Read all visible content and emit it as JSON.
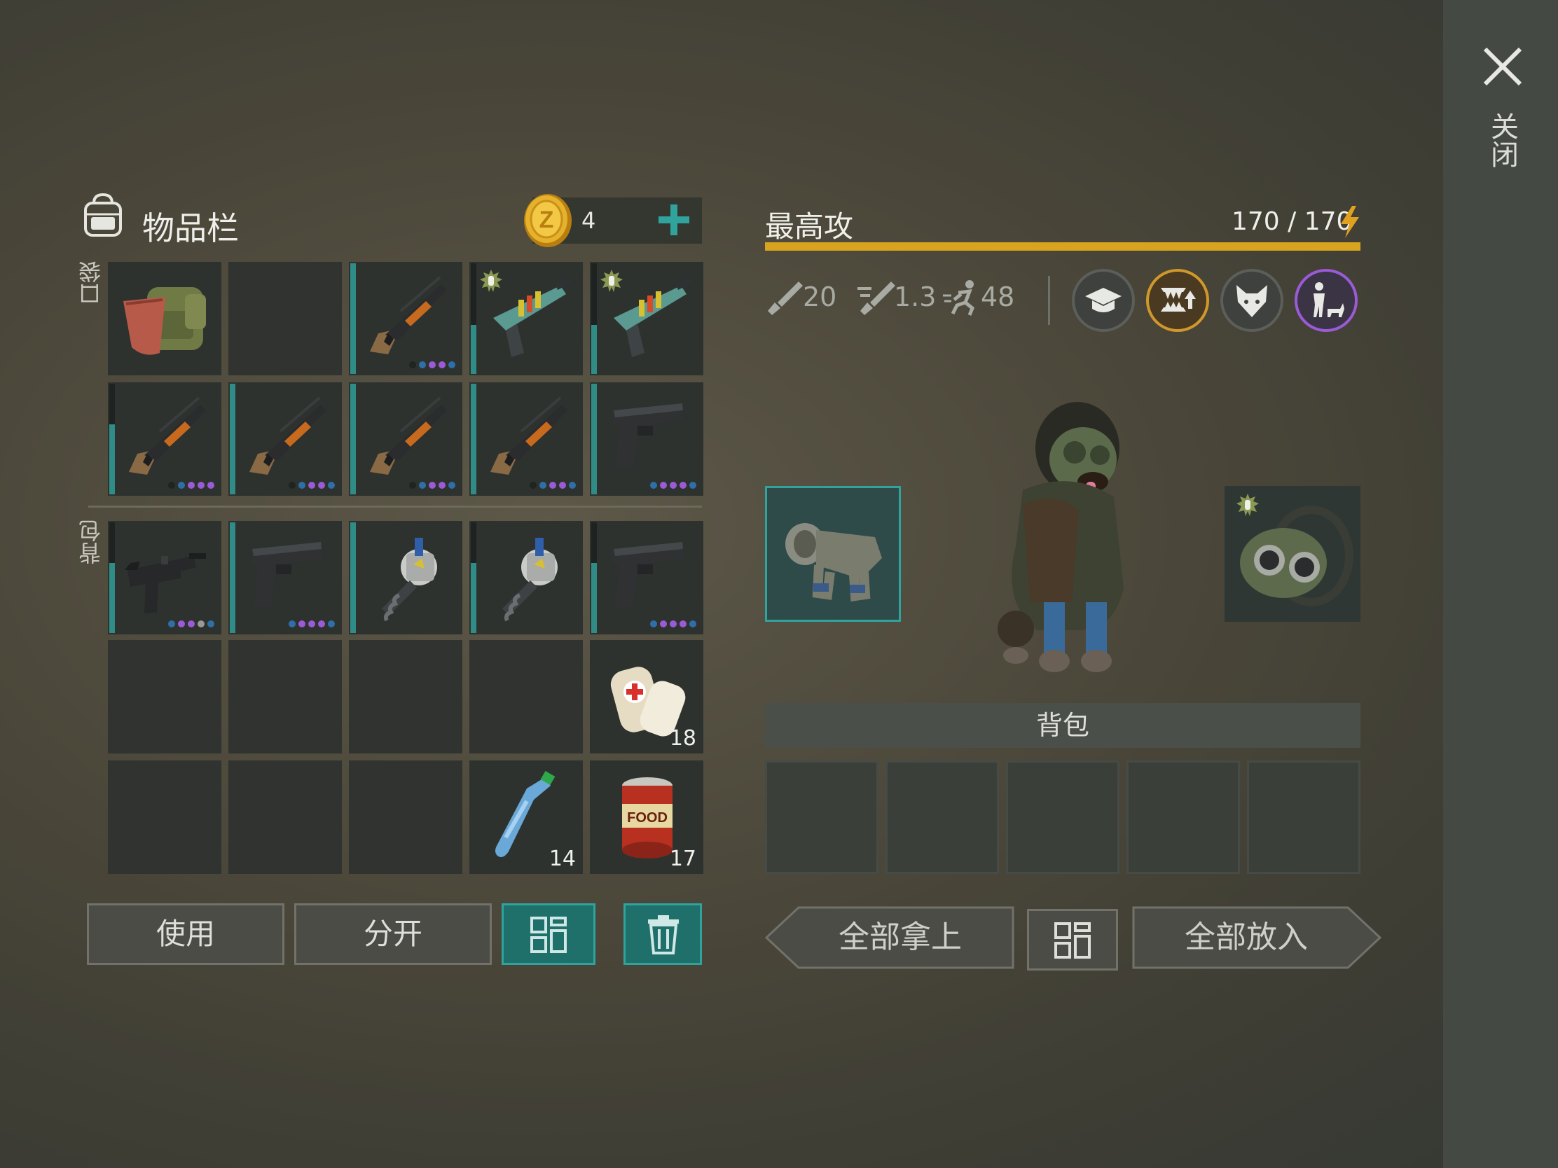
{
  "window": {
    "close_label": "关闭"
  },
  "inventory": {
    "title": "物品栏",
    "coins": "4",
    "pocket_label": "口袋",
    "backpack_label": "背包",
    "pocket_slots": [
      {
        "item": "backpack-with-bandana",
        "qty": ""
      },
      {
        "item": "empty",
        "qty": ""
      },
      {
        "item": "shotgun",
        "qty": ""
      },
      {
        "item": "flare-blaster",
        "qty": ""
      },
      {
        "item": "flare-blaster",
        "qty": ""
      },
      {
        "item": "shotgun",
        "qty": ""
      },
      {
        "item": "shotgun",
        "qty": ""
      },
      {
        "item": "shotgun",
        "qty": ""
      },
      {
        "item": "shotgun",
        "qty": ""
      },
      {
        "item": "pistol",
        "qty": ""
      }
    ],
    "backpack_slots": [
      {
        "item": "uzi",
        "qty": ""
      },
      {
        "item": "pistol",
        "qty": ""
      },
      {
        "item": "drill",
        "qty": ""
      },
      {
        "item": "drill",
        "qty": ""
      },
      {
        "item": "pistol",
        "qty": ""
      },
      {
        "item": "empty",
        "qty": ""
      },
      {
        "item": "empty",
        "qty": ""
      },
      {
        "item": "empty",
        "qty": ""
      },
      {
        "item": "empty",
        "qty": ""
      },
      {
        "item": "bandage",
        "qty": "18"
      },
      {
        "item": "empty",
        "qty": ""
      },
      {
        "item": "empty",
        "qty": ""
      },
      {
        "item": "empty",
        "qty": ""
      },
      {
        "item": "water-bottle",
        "qty": "14"
      },
      {
        "item": "canned-food",
        "qty": "17"
      }
    ],
    "use_label": "使用",
    "split_label": "分开"
  },
  "pet": {
    "name": "最高攻",
    "energy": "170 / 170",
    "energy_fraction": 1.0,
    "attack": "20",
    "attack_speed": "1.3",
    "move_speed": "48",
    "skills": [
      "graduation-cap-icon",
      "jaws-upgrade-icon",
      "fox-head-icon",
      "owner-with-pet-icon"
    ],
    "bag_title": "背包",
    "take_all_label": "全部拿上",
    "put_all_label": "全部放入"
  },
  "colors": {
    "accent_teal": "#2f8c87",
    "energy_gold": "#d8a420",
    "dot_purple": "#9b5ad6",
    "dot_blue": "#2f6fa8"
  }
}
